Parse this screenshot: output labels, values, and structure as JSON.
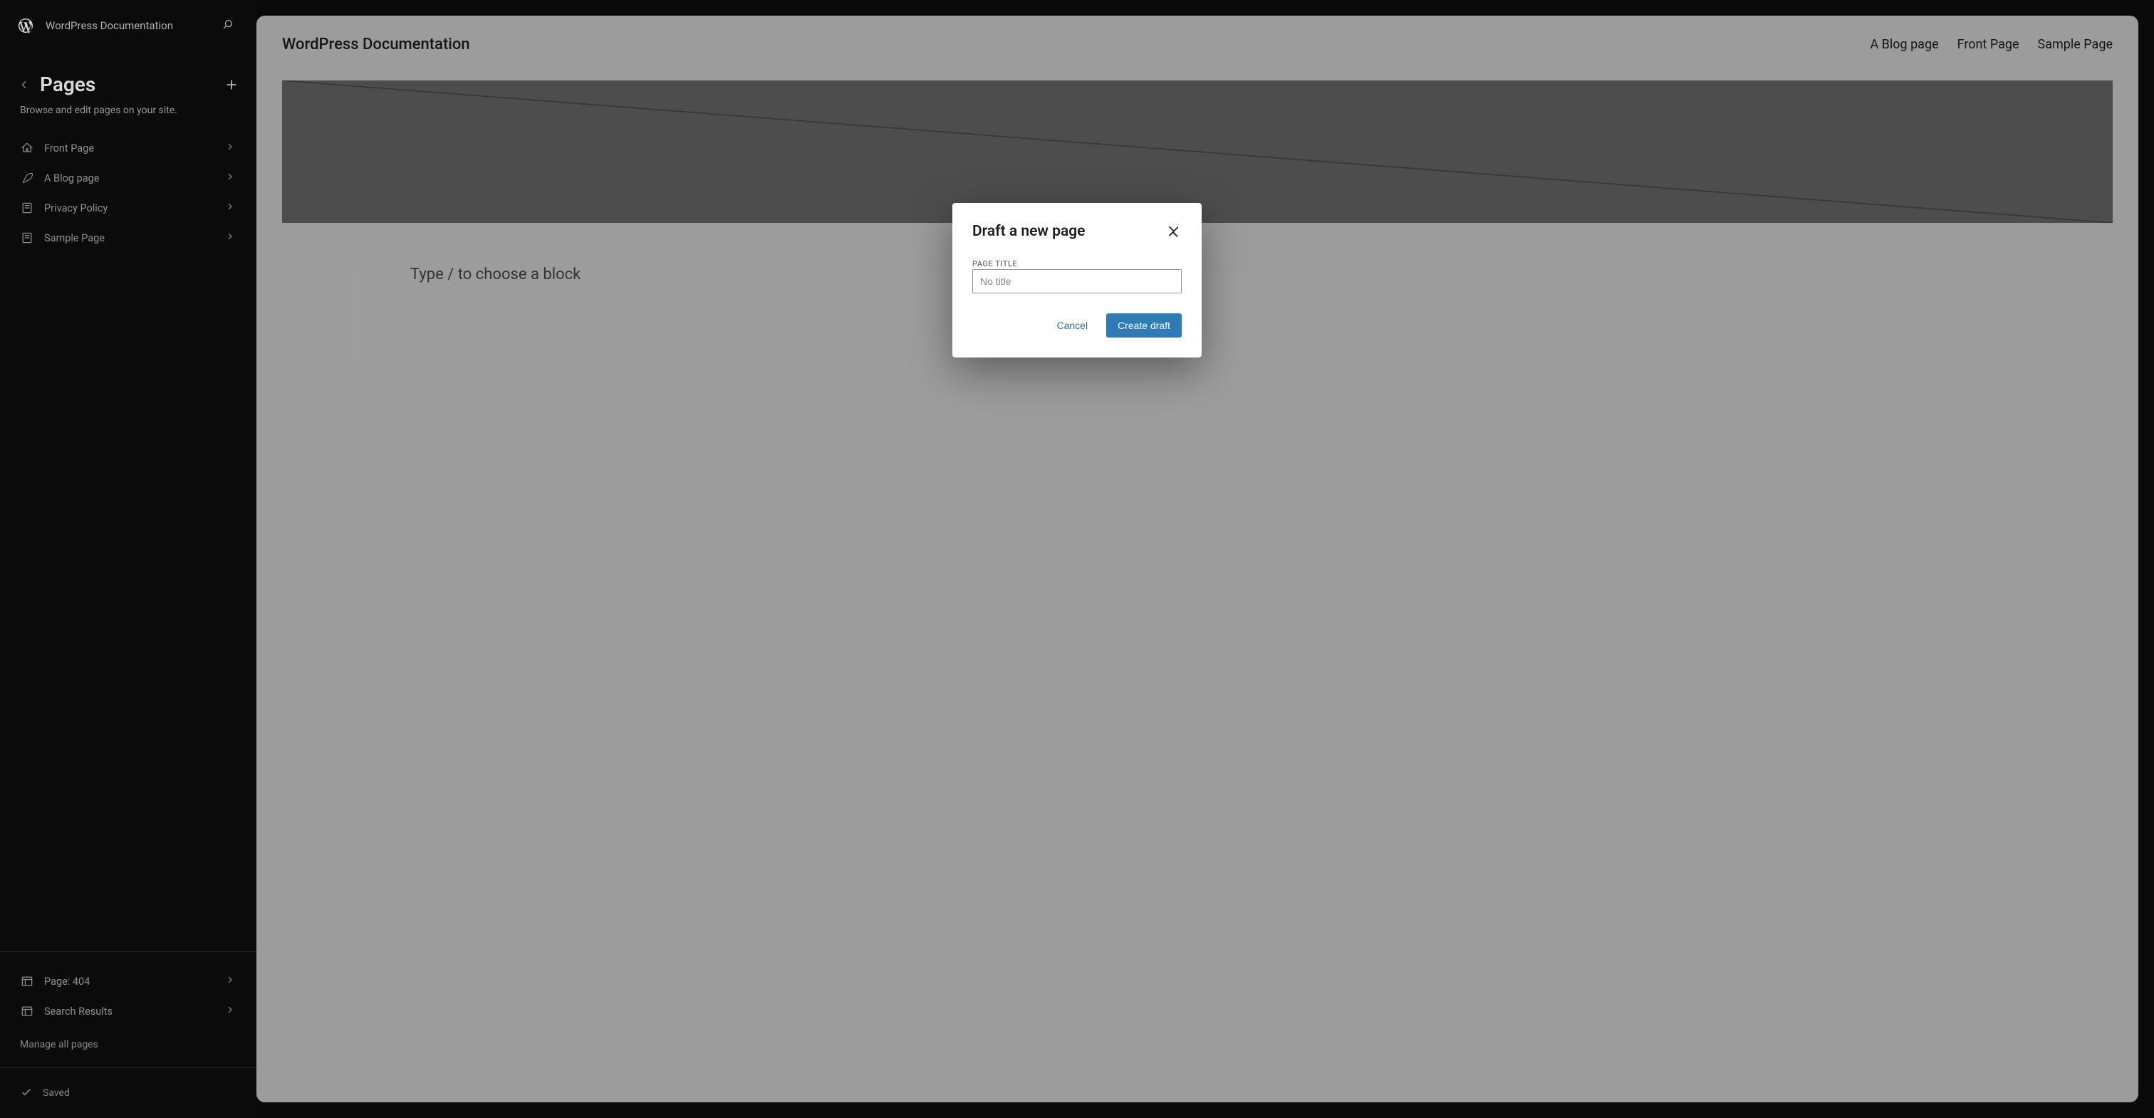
{
  "site": {
    "name": "WordPress Documentation"
  },
  "sidebar": {
    "title": "Pages",
    "description": "Browse and edit pages on your site.",
    "items": [
      {
        "label": "Front Page",
        "icon": "home"
      },
      {
        "label": "A Blog page",
        "icon": "feather"
      },
      {
        "label": "Privacy Policy",
        "icon": "page"
      },
      {
        "label": "Sample Page",
        "icon": "page"
      }
    ],
    "bottom_items": [
      {
        "label": "Page: 404",
        "icon": "layout"
      },
      {
        "label": "Search Results",
        "icon": "layout"
      }
    ],
    "manage_label": "Manage all pages",
    "saved_label": "Saved"
  },
  "canvas": {
    "site_title": "WordPress Documentation",
    "nav": [
      "A Blog page",
      "Front Page",
      "Sample Page"
    ],
    "block_prompt": "Type / to choose a block"
  },
  "modal": {
    "title": "Draft a new page",
    "field_label": "PAGE TITLE",
    "placeholder": "No title",
    "cancel_label": "Cancel",
    "submit_label": "Create draft"
  }
}
